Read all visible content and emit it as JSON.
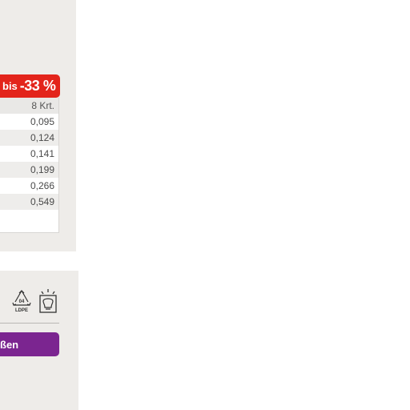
{
  "discount_badge": {
    "prefix": "bis",
    "value": "-33 %"
  },
  "price_table": {
    "header": "8 Krt.",
    "rows": [
      "0,095",
      "0,124",
      "0,141",
      "0,199",
      "0,266",
      "0,549"
    ]
  },
  "icons": {
    "recycle_code": "04",
    "recycle_material": "LDPE",
    "bulb_icon": "light-bulb-icon",
    "recycle_icon": "recycle-ldpe-icon"
  },
  "action_button": {
    "label": "ßen"
  },
  "colors": {
    "badge_red": "#e3241b",
    "button_purple": "#7b2590",
    "panel_grey": "#eeece9"
  }
}
